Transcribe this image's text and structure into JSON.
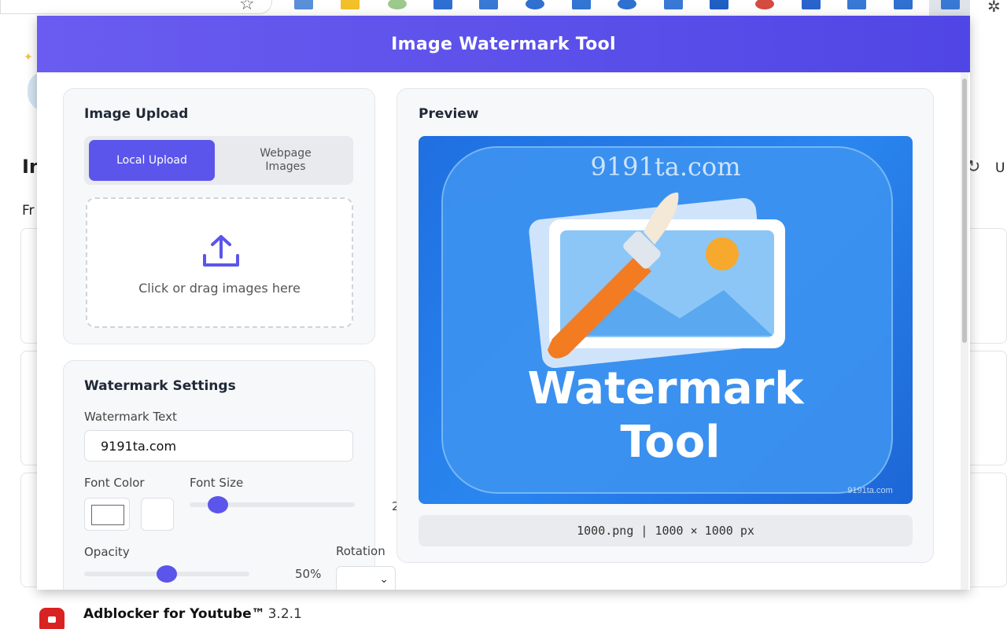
{
  "browser": {
    "extension_icons": [
      "translate-icon",
      "note-icon",
      "palette-icon",
      "grid-icon",
      "doc-icon",
      "clock-icon",
      "lock-icon",
      "pen-icon",
      "box-icon",
      "tool-icon",
      "chrome-icon",
      "stairs-icon",
      "slides-icon",
      "screen-icon",
      "watermark-ext-icon"
    ]
  },
  "background": {
    "heading_fragment": "In",
    "subheading_fragment": "Fr",
    "right_fragment": "U",
    "adblock": {
      "name": "Adblocker for Youtube™",
      "version": "3.2.1"
    }
  },
  "popup": {
    "title": "Image Watermark Tool",
    "upload": {
      "title": "Image Upload",
      "tabs": [
        "Local Upload",
        "Webpage Images"
      ],
      "active_tab": "Local Upload",
      "drop_text": "Click or drag images here"
    },
    "settings": {
      "title": "Watermark Settings",
      "text_label": "Watermark Text",
      "text_value": "9191ta.com",
      "font_color_label": "Font Color",
      "font_size_label": "Font Size",
      "font_size_value_fragment": "2",
      "opacity_label": "Opacity",
      "opacity_value": "50%",
      "opacity_level": 0.5,
      "rotation_label": "Rotation"
    },
    "preview": {
      "title": "Preview",
      "watermark_overlay": "9191ta.com",
      "image_caption_line1": "Watermark",
      "image_caption_line2": "Tool",
      "corner_mark": "9191ta.com",
      "info": "1000.png | 1000 × 1000 px"
    }
  },
  "colors": {
    "accent": "#5b55eb",
    "header_start": "#6a5cf0",
    "header_end": "#5046e5",
    "image_bg": "#2a86ef"
  }
}
